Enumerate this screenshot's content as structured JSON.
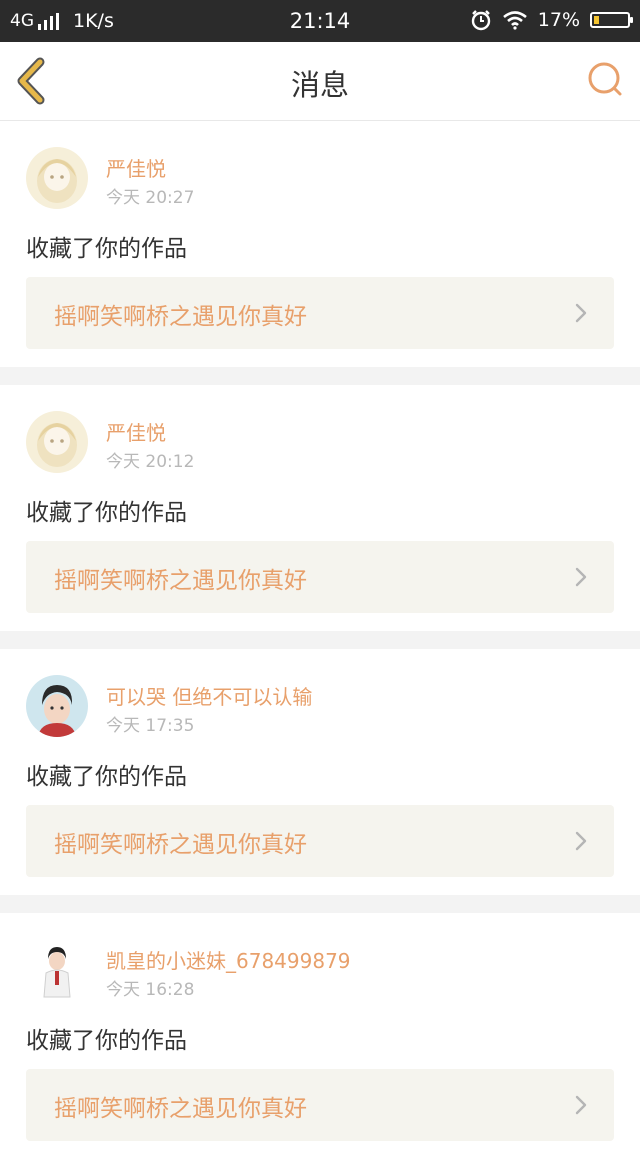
{
  "status_bar": {
    "network": "4G",
    "speed": "1K/s",
    "time": "21:14",
    "battery": "17%",
    "battery_level": 0.17
  },
  "header": {
    "title": "消息",
    "back_icon": "chevron-left-icon",
    "search_icon": "search-icon"
  },
  "colors": {
    "accent": "#e8a06b",
    "back_icon": "#e6b84a",
    "card_bg": "#f5f4ee"
  },
  "messages": [
    {
      "username": "严佳悦",
      "time": "今天 20:27",
      "action": "收藏了你的作品",
      "work_title": "摇啊笑啊桥之遇见你真好",
      "avatar": "anime-girl-avatar"
    },
    {
      "username": "严佳悦",
      "time": "今天 20:12",
      "action": "收藏了你的作品",
      "work_title": "摇啊笑啊桥之遇见你真好",
      "avatar": "anime-girl-avatar"
    },
    {
      "username": "可以哭 但绝不可以认输",
      "time": "今天 17:35",
      "action": "收藏了你的作品",
      "work_title": "摇啊笑啊桥之遇见你真好",
      "avatar": "boy-portrait-avatar"
    },
    {
      "username": "凯皇的小迷妹_678499879",
      "time": "今天 16:28",
      "action": "收藏了你的作品",
      "work_title": "摇啊笑啊桥之遇见你真好",
      "avatar": "boy-fullbody-avatar"
    }
  ]
}
